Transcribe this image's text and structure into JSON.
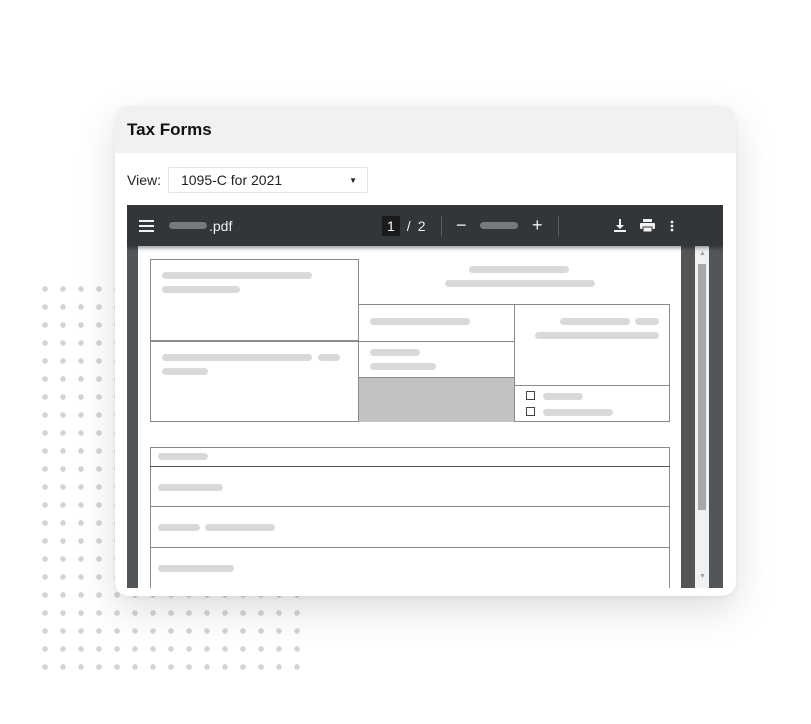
{
  "card": {
    "title": "Tax Forms",
    "view_label": "View:",
    "view_select": {
      "selected": "1095-C for 2021"
    }
  },
  "viewer": {
    "toolbar": {
      "filename_suffix": ".pdf",
      "current_page": "1",
      "page_separator": "/",
      "total_pages": "2",
      "zoom_out": "−",
      "zoom_in": "+"
    },
    "icons": [
      "menu-icon",
      "download-icon",
      "print-icon",
      "more-vert-icon",
      "scroll-up-icon",
      "scroll-down-icon"
    ]
  },
  "colors": {
    "toolbar_bg": "#323639",
    "viewer_bg": "#525659",
    "header_bg": "#f1f1f1",
    "shaded_cell": "#c2c2c2"
  }
}
